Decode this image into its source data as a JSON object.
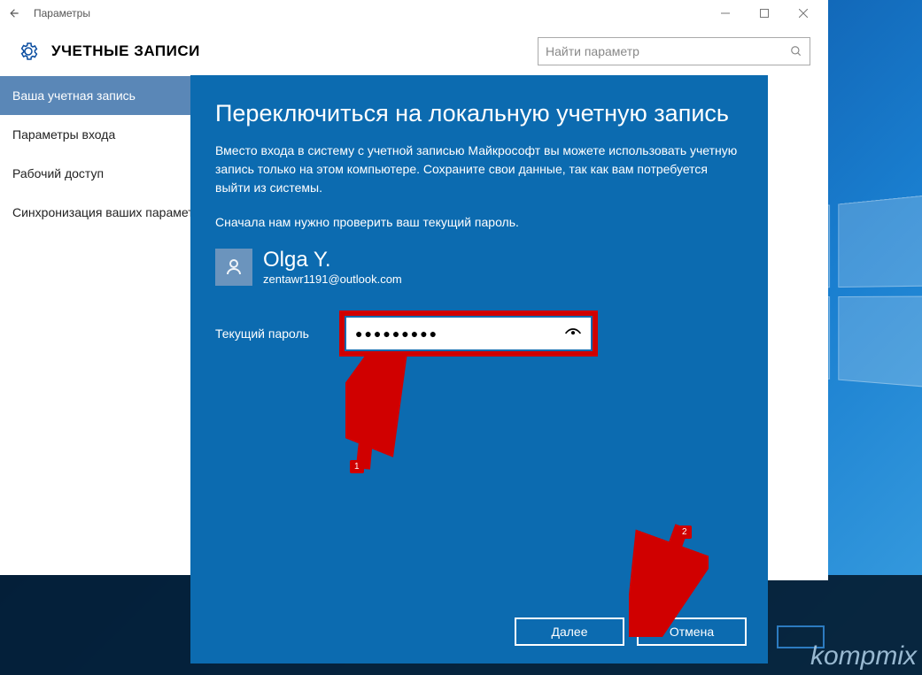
{
  "titlebar": {
    "title": "Параметры"
  },
  "header": {
    "title": "УЧЕТНЫЕ ЗАПИСИ"
  },
  "search": {
    "placeholder": "Найти параметр"
  },
  "sidebar": {
    "items": [
      {
        "label": "Ваша учетная запись",
        "selected": true
      },
      {
        "label": "Параметры входа"
      },
      {
        "label": "Рабочий доступ"
      },
      {
        "label": "Синхронизация ваших параметров"
      }
    ]
  },
  "modal": {
    "title": "Переключиться на локальную учетную запись",
    "para1": "Вместо входа в систему с учетной записью Майкрософт вы можете использовать учетную запись только на этом компьютере. Сохраните свои данные, так как вам потребуется выйти из системы.",
    "para2": "Сначала нам нужно проверить ваш текущий пароль.",
    "user_name": "Olga Y.",
    "user_email": "zentawr1191@outlook.com",
    "password_label": "Текущий пароль",
    "password_value": "●●●●●●●●●",
    "next_label": "Далее",
    "cancel_label": "Отмена"
  },
  "annotations": {
    "n1": "1",
    "n2": "2"
  },
  "watermark": "kompmix"
}
